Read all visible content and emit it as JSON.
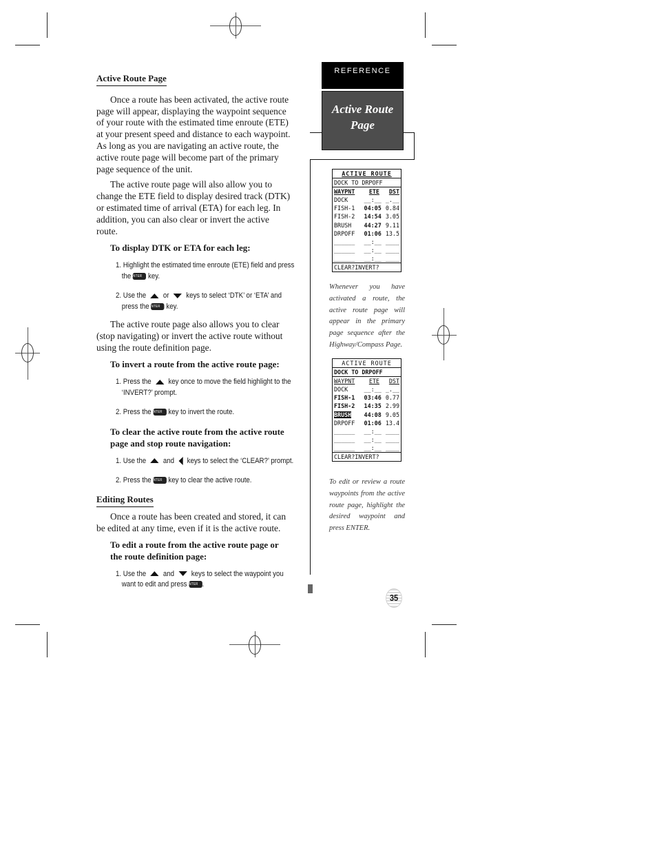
{
  "sidebar": {
    "section_tab": "REFERENCE",
    "title_line1": "Active Route",
    "title_line2": "Page"
  },
  "main": {
    "section1": {
      "heading": "Active Route Page",
      "para1": "Once a route has been activated, the active route page will appear, displaying the waypoint sequence of your route with the estimated time enroute (ETE) at your present speed and distance to each waypoint. As long as you are navigating an active route, the active route page will become part of the primary page sequence of the unit.",
      "para2": "The active route page will also allow you to change the ETE field to display desired track (DTK) or estimated time of arrival (ETA) for each leg. In addition, you can also clear or invert the active route.",
      "proc1": {
        "title": "To display DTK or ETA for each leg:",
        "step1_a": "1. Highlight the estimated time enroute (ETE) field and press the",
        "step1_b": "key.",
        "step2_a": "2. Use the",
        "step2_b": "or",
        "step2_c": "keys to select ‘DTK’ or ‘ETA’ and press the",
        "step2_d": "key."
      },
      "para3": "The active route page also allows you to clear (stop navigating) or invert the active route without using the route definition page.",
      "proc2": {
        "title": "To invert a route from the active route page:",
        "step1_a": "1. Press the",
        "step1_b": "key once to move the field highlight to the ‘INVERT?’ prompt.",
        "step2_a": "2. Press the",
        "step2_b": "key to invert the route."
      },
      "proc3": {
        "title": "To clear the active route from the active route page and stop route navigation:",
        "step1_a": "1. Use the",
        "step1_b": "and",
        "step1_c": "keys to select the ‘CLEAR?’ prompt.",
        "step2_a": "2. Press the",
        "step2_b": "key to clear the active route."
      }
    },
    "section2": {
      "heading": "Editing Routes",
      "para1": "Once a route has been created and stored, it can be edited at any time, even if it is the active route.",
      "proc1": {
        "title": "To edit a route from the active route page or the route definition page:",
        "step1_a": "1. Use the",
        "step1_b": "and",
        "step1_c": "keys to select the waypoint you want to edit and press",
        "step1_d": "."
      }
    },
    "enter_key_label": "ENTER"
  },
  "screens": [
    {
      "title": "ACTIVE ROUTE",
      "route_name": "DOCK TO DRPOFF",
      "headers": [
        "WAYPNT",
        "ETE",
        "DST"
      ],
      "rows": [
        {
          "wpt": "DOCK",
          "ete": "__:__",
          "dst": "_.__"
        },
        {
          "wpt": "FISH-1",
          "ete": "04:05",
          "dst": "0.84"
        },
        {
          "wpt": "FISH-2",
          "ete": "14:54",
          "dst": "3.05"
        },
        {
          "wpt": "BRUSH",
          "ete": "44:27",
          "dst": "9.11"
        },
        {
          "wpt": "DRPOFF",
          "ete": "01:06",
          "dst": "13.5"
        },
        {
          "wpt": "______",
          "ete": "__:__",
          "dst": "____"
        },
        {
          "wpt": "______",
          "ete": "__:__",
          "dst": "____"
        },
        {
          "wpt": "______",
          "ete": "__:__",
          "dst": "____"
        }
      ],
      "footer": "CLEAR?INVERT?",
      "caption": "Whenever you have activated a route, the active route page will appear in the primary page sequence after the Highway/Compass Page."
    },
    {
      "title": "ACTIVE ROUTE",
      "route_name": "DOCK TO DRPOFF",
      "headers": [
        "WAYPNT",
        "ETE",
        "DST"
      ],
      "rows": [
        {
          "wpt": "DOCK",
          "ete": "__:__",
          "dst": "_.__"
        },
        {
          "wpt": "FISH-1",
          "ete": "03:46",
          "dst": "0.77"
        },
        {
          "wpt": "FISH-2",
          "ete": "14:35",
          "dst": "2.99"
        },
        {
          "wpt": "BRUSH",
          "ete": "44:08",
          "dst": "9.05"
        },
        {
          "wpt": "DRPOFF",
          "ete": "01:06",
          "dst": "13.4"
        },
        {
          "wpt": "______",
          "ete": "__:__",
          "dst": "____"
        },
        {
          "wpt": "______",
          "ete": "__:__",
          "dst": "____"
        },
        {
          "wpt": "______",
          "ete": "__:__",
          "dst": "____"
        }
      ],
      "highlighted_waypoint": "BRUSH",
      "footer": "CLEAR?INVERT?",
      "caption": "To edit or review a route waypoints from the active route page, highlight the desired waypoint and press ENTER."
    }
  ],
  "page_number": "35"
}
